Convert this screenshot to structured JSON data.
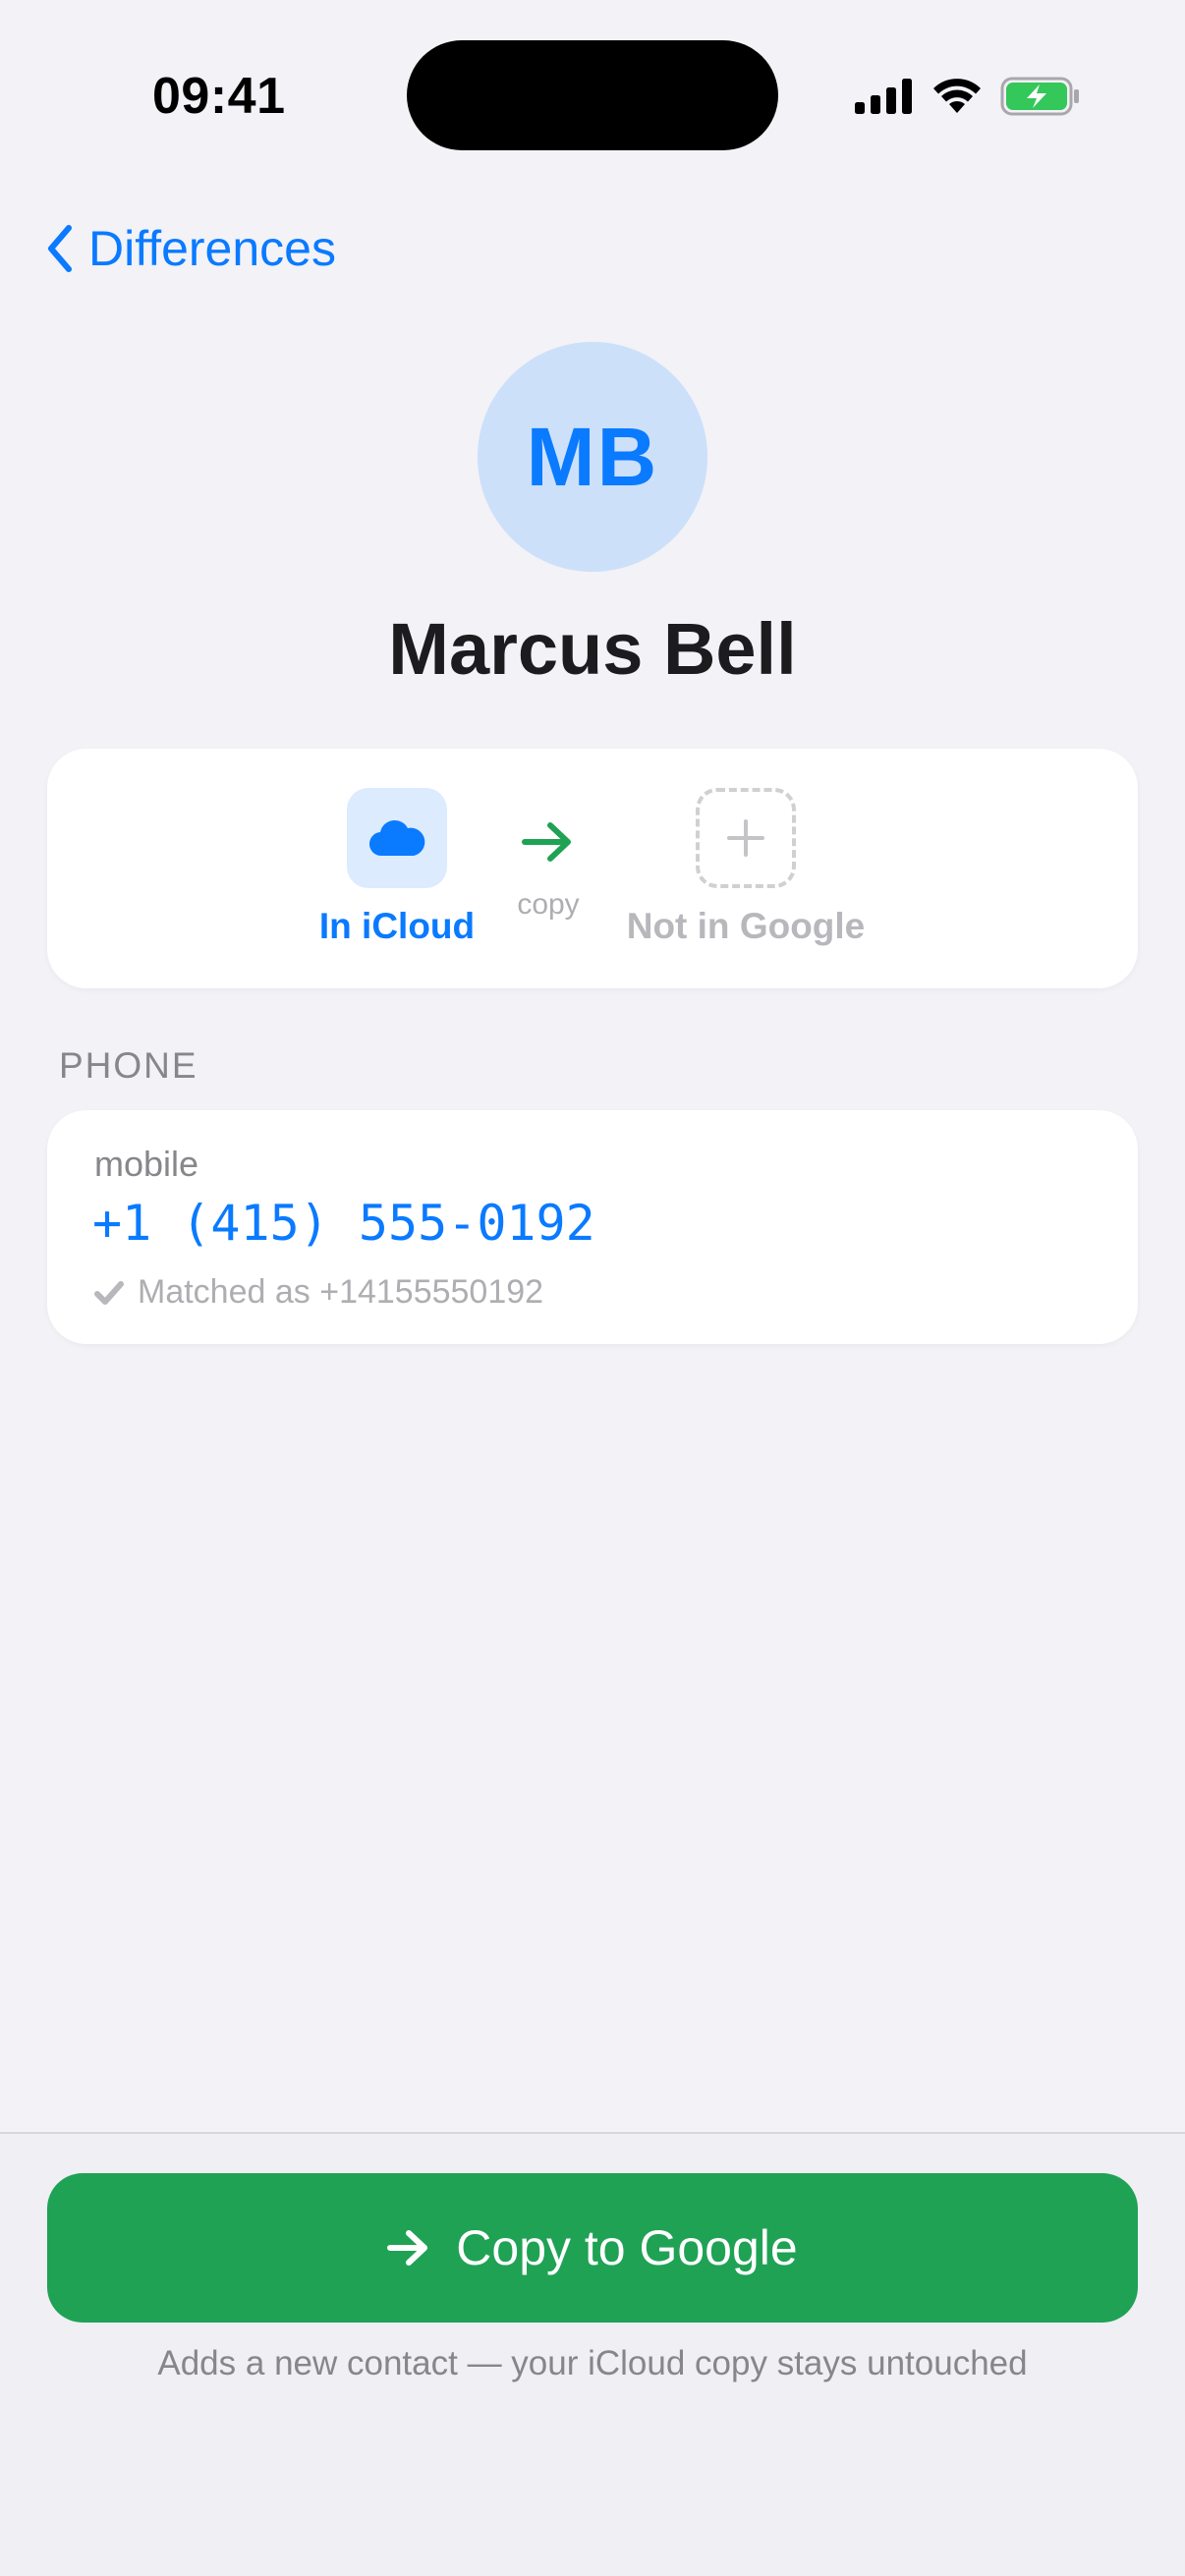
{
  "status_bar": {
    "time": "09:41",
    "icons": [
      "signal-icon",
      "wifi-icon",
      "battery-charging-icon"
    ]
  },
  "nav": {
    "back_label": "Differences"
  },
  "contact": {
    "initials": "MB",
    "name": "Marcus Bell"
  },
  "sync": {
    "source_label": "In iCloud",
    "action_label": "copy",
    "destination_label": "Not in Google",
    "source_icon": "cloud-icon",
    "destination_icon": "plus-icon",
    "action_icon": "arrow-right-icon"
  },
  "phone_section": {
    "header": "PHONE",
    "entries": [
      {
        "type": "mobile",
        "number": "+1 (415) 555-0192",
        "match_text": "Matched as +14155550192"
      }
    ]
  },
  "actions": {
    "primary_label": "Copy to Google",
    "footnote": "Adds a new contact — your iCloud copy stays untouched"
  },
  "colors": {
    "accent_blue": "#0A7AFF",
    "action_green": "#1FA254",
    "background": "#F2F2F7",
    "card": "#FFFFFF",
    "secondary_text": "#86868B"
  }
}
